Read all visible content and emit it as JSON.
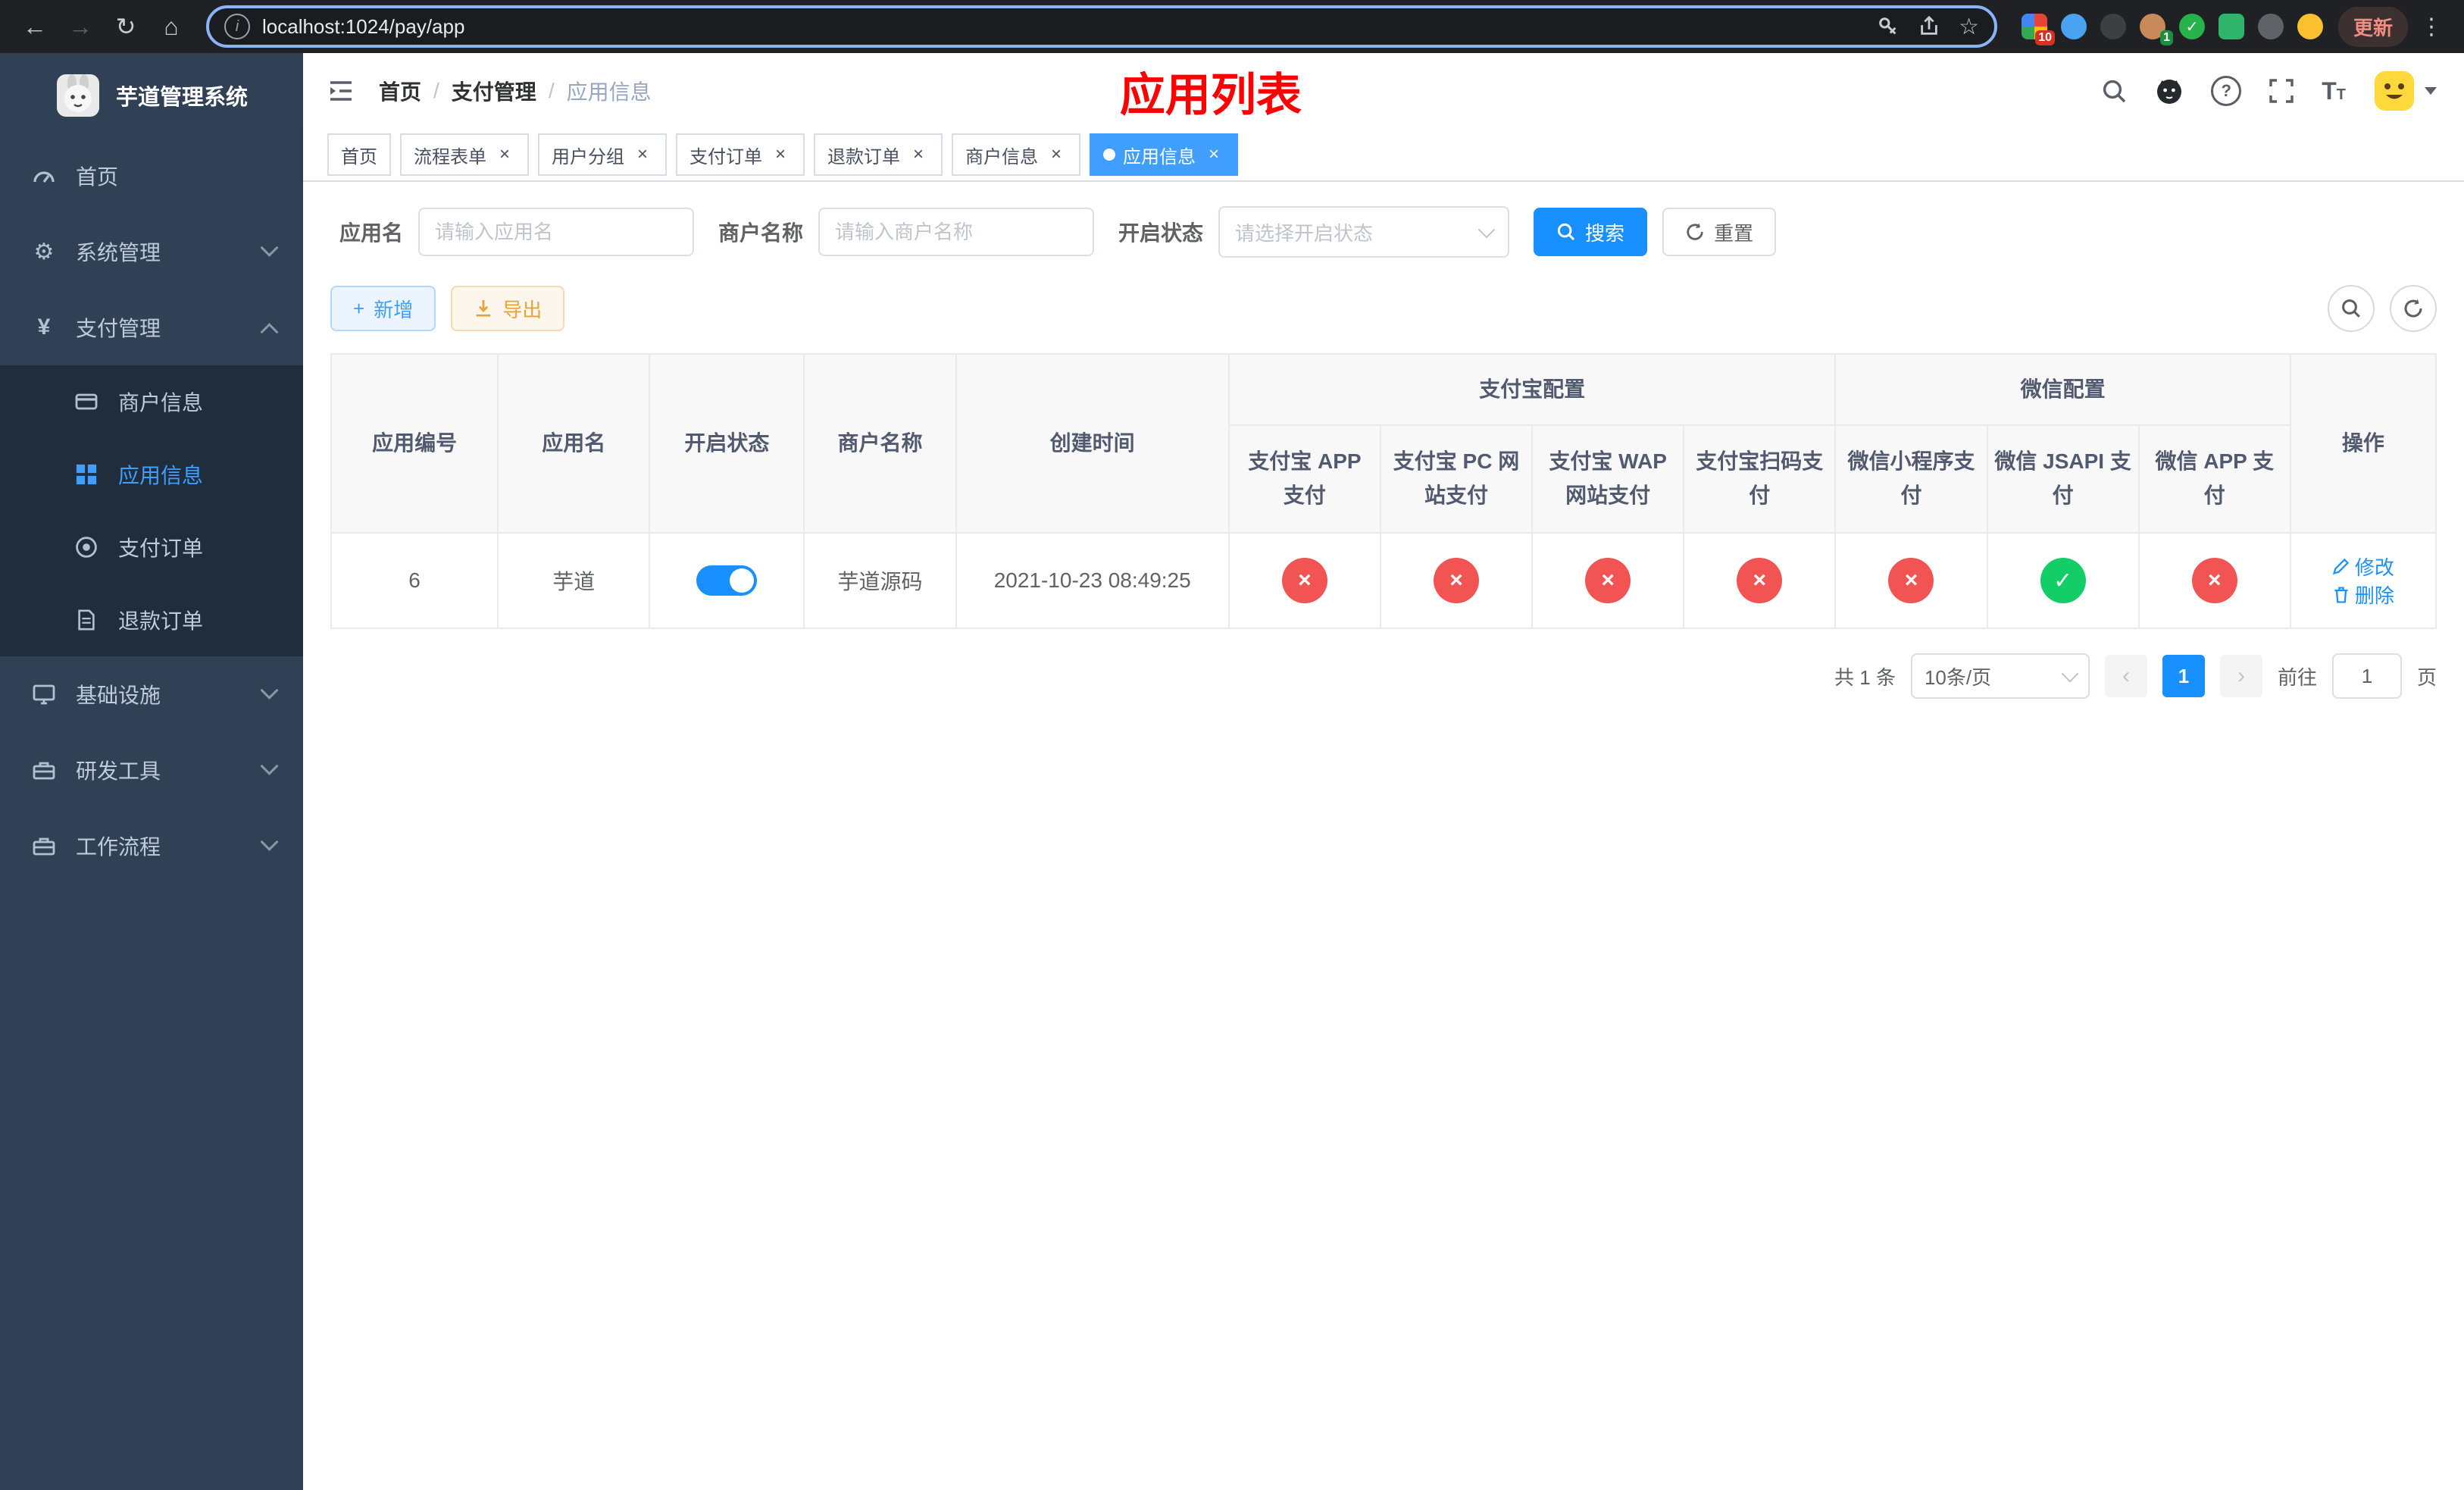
{
  "browser": {
    "url": "localhost:1024/pay/app",
    "update_label": "更新",
    "ext_badge_apps": "10",
    "ext_badge_avatar": "1"
  },
  "icons": {
    "back": "←",
    "forward": "→",
    "reload": "↻",
    "home": "⌂",
    "star": "☆",
    "kebab": "⋮",
    "info": "i",
    "close": "×",
    "prev": "‹",
    "next": "›",
    "question": "?",
    "plus": "+",
    "yen": "¥",
    "gear": "⚙",
    "grid": "▦",
    "target": "◉",
    "check": "✓",
    "cross": "×"
  },
  "sidebar": {
    "title": "芋道管理系统",
    "items": {
      "home": "首页",
      "system": "系统管理",
      "payment": "支付管理",
      "infra": "基础设施",
      "devtools": "研发工具",
      "workflow": "工作流程"
    },
    "payment_children": {
      "merchant": "商户信息",
      "app": "应用信息",
      "order": "支付订单",
      "refund": "退款订单"
    }
  },
  "header": {
    "breadcrumb": [
      "首页",
      "支付管理",
      "应用信息"
    ],
    "breadcrumb_separator": "/",
    "page_title": "应用列表"
  },
  "tabs": [
    {
      "label": "首页"
    },
    {
      "label": "流程表单"
    },
    {
      "label": "用户分组"
    },
    {
      "label": "支付订单"
    },
    {
      "label": "退款订单"
    },
    {
      "label": "商户信息"
    },
    {
      "label": "应用信息",
      "active": true
    }
  ],
  "filters": {
    "app_name_label": "应用名",
    "app_name_placeholder": "请输入应用名",
    "merchant_label": "商户名称",
    "merchant_placeholder": "请输入商户名称",
    "status_label": "开启状态",
    "status_placeholder": "请选择开启状态",
    "search_label": "搜索",
    "reset_label": "重置"
  },
  "toolbar": {
    "add_label": "新增",
    "export_label": "导出"
  },
  "table": {
    "columns": {
      "id": "应用编号",
      "name": "应用名",
      "status": "开启状态",
      "merchant": "商户名称",
      "created": "创建时间",
      "ops": "操作"
    },
    "groups": {
      "alipay": "支付宝配置",
      "wechat": "微信配置"
    },
    "sub_columns": [
      "支付宝 APP 支付",
      "支付宝 PC 网站支付",
      "支付宝 WAP 网站支付",
      "支付宝扫码支付",
      "微信小程序支付",
      "微信 JSAPI 支付",
      "微信 APP 支付"
    ],
    "rows": [
      {
        "id": "6",
        "name": "芋道",
        "enabled": true,
        "merchant": "芋道源码",
        "created": "2021-10-23 08:49:25",
        "statuses": [
          false,
          false,
          false,
          false,
          false,
          true,
          false
        ],
        "edit_label": "修改",
        "delete_label": "删除"
      }
    ]
  },
  "pagination": {
    "total": "共 1 条",
    "page_size": "10条/页",
    "current_page": "1",
    "goto_label": "前往",
    "goto_value": "1",
    "page_unit": "页"
  },
  "colors": {
    "accent": "#1890ff",
    "sidebar_bg": "#304156",
    "submenu_bg": "#1f2d3d",
    "danger": "#f25454",
    "success": "#13ce66",
    "title_red": "#ff0000"
  }
}
